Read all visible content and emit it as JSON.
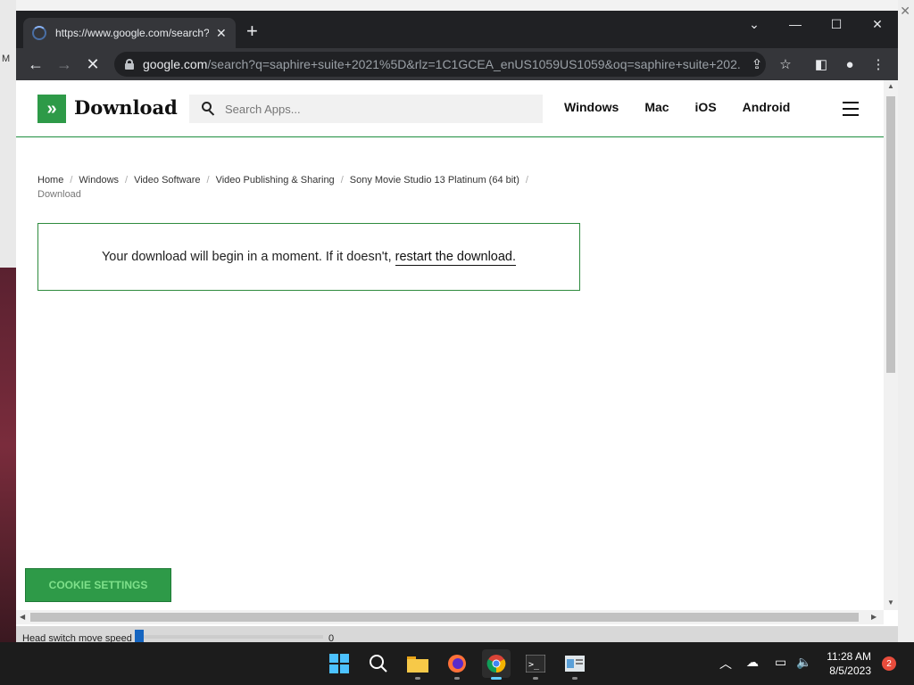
{
  "browser": {
    "tab_title": "https://www.google.com/search?",
    "url_domain": "google.com",
    "url_path": "/search?q=saphire+suite+2021%5D&rlz=1C1GCEA_enUS1059US1059&oq=saphire+suite+202..."
  },
  "site": {
    "logo_text": "Download",
    "search_placeholder": "Search Apps...",
    "nav": [
      "Windows",
      "Mac",
      "iOS",
      "Android"
    ]
  },
  "breadcrumb": {
    "items": [
      "Home",
      "Windows",
      "Video Software",
      "Video Publishing & Sharing",
      "Sony Movie Studio 13 Platinum (64 bit)"
    ],
    "current": "Download"
  },
  "notice": {
    "text": "Your download will begin in a moment. If it doesn't,",
    "link": "restart the download."
  },
  "cookie_button": "COOKIE SETTINGS",
  "stray_slider": {
    "label": "Head switch move speed",
    "value": "0"
  },
  "taskbar": {
    "time": "11:28 AM",
    "date": "8/5/2023",
    "notification_count": "2"
  },
  "colors": {
    "brand_green": "#2e9a48",
    "browser_dark": "#202124",
    "browser_toolbar": "#35363a"
  }
}
